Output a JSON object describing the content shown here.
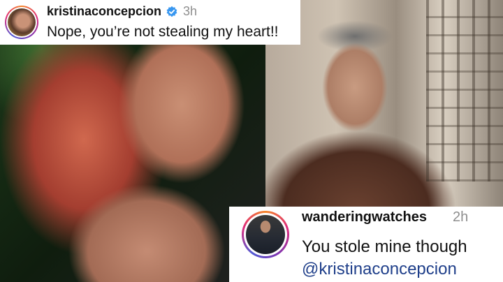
{
  "top_comment": {
    "username": "kristinaconcepcion",
    "time": "3h",
    "text": "Nope, you’re not stealing my heart!!",
    "verified_icon": "verified-badge-icon",
    "verified_color": "#3897f0"
  },
  "bottom_comment": {
    "username": "wanderingwatches",
    "time": "2h",
    "text": "You stole mine though",
    "mention": "@kristinaconcepcion"
  },
  "colors": {
    "story_ring": [
      "#f58529",
      "#dd2a7b",
      "#8134af",
      "#515bd4"
    ],
    "mention": "#1f3f8a",
    "timestamp": "#8e8e8e"
  }
}
